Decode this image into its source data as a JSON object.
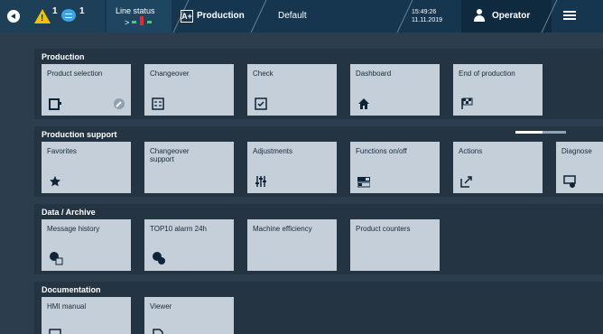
{
  "topbar": {
    "warning_count": "1",
    "message_count": "1",
    "line_status_label": "Line status",
    "line_status_arrow": ">",
    "mode_icon": "A+",
    "mode_label": "Production",
    "default_label": "Default",
    "time": "15:49:26",
    "date": "11.11.2019",
    "operator_label": "Operator"
  },
  "sections": {
    "production": {
      "title": "Production",
      "tiles": [
        "Product selection",
        "Changeover",
        "Check",
        "Dashboard",
        "End of production"
      ]
    },
    "support": {
      "title": "Production support",
      "tiles": [
        "Favorites",
        "Changeover support",
        "Adjustments",
        "Functions on/off",
        "Actions",
        "Diagnose"
      ]
    },
    "archive": {
      "title": "Data / Archive",
      "tiles": [
        "Message history",
        "TOP10 alarm 24h",
        "Machine efficiency",
        "Product counters"
      ]
    },
    "documentation": {
      "title": "Documentation",
      "tiles": [
        "HMI manual",
        "Viewer"
      ]
    }
  },
  "colors": {
    "warning": "#f2c200",
    "message": "#3aa3e0",
    "status_green": "#3bd26b",
    "status_red": "#e52b2b",
    "tile": "#c4cfd9"
  }
}
